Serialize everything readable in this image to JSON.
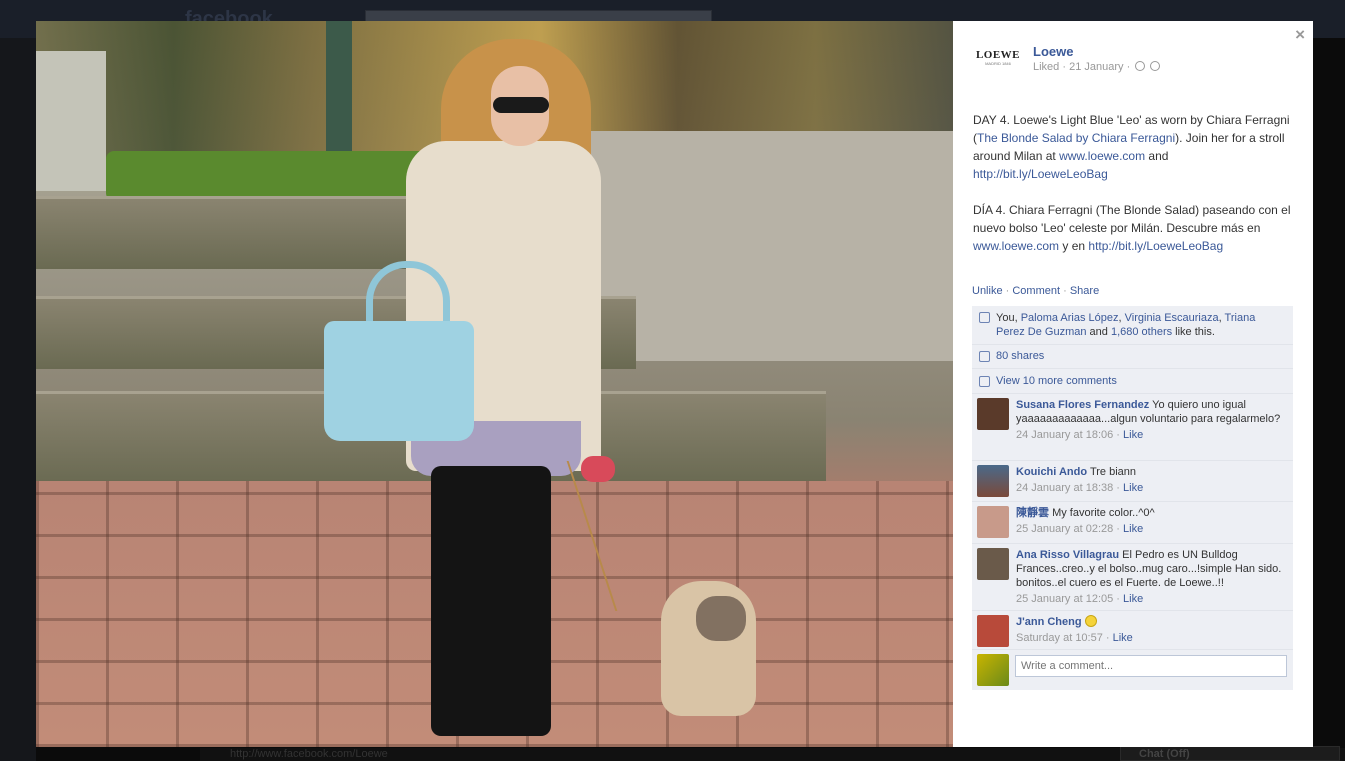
{
  "background_page": {
    "site_logo": "facebook",
    "status_url": "http://www.facebook.com/Loewe",
    "chat_label": "Chat (Off)"
  },
  "photo": {
    "alt": "Chiara Ferragni walking a French bulldog, carrying a light blue Loewe Leo bag"
  },
  "close_label": "×",
  "post": {
    "page_name": "Loewe",
    "logo_word": "LOEWE",
    "logo_sub": "MADRID 1846",
    "meta_liked": "Liked",
    "meta_date": "21 January",
    "text_en_1": "DAY 4. Loewe's Light Blue 'Leo' as worn by Chiara Ferragni (",
    "link_blonde_salad": "The Blonde Salad by Chiara Ferragni",
    "text_en_2": "). Join her for a stroll around Milan at ",
    "link_site": "www.loewe.com",
    "text_en_3": " and",
    "link_bitly": "http://bit.ly/LoeweLeoBag",
    "text_es_1": "DÍA 4. Chiara Ferragni (The Blonde Salad) paseando con el nuevo bolso 'Leo' celeste por Milán. Descubre más en ",
    "text_es_2": " y en",
    "actions": {
      "unlike": "Unlike",
      "comment": "Comment",
      "share": "Share",
      "sep": " · "
    }
  },
  "likes": {
    "you": "You, ",
    "names": [
      "Paloma Arias López",
      "Virginia Escauriaza",
      "Triana Perez De Guzman"
    ],
    "and": " and ",
    "others": "1,680 others",
    "tail": " like this.",
    "comma": ", "
  },
  "shares": "80 shares",
  "view_more": "View 10 more comments",
  "comments": [
    {
      "author": "Susana Flores Fernandez",
      "text": "Yo quiero uno igual yaaaaaaaaaaaaa...algun voluntario para regalarmelo?",
      "time": "24 January at 18:06",
      "like": "Like",
      "avatar_color": "#5a3a2a"
    },
    {
      "author": "Kouichi Ando",
      "text": "Tre biann",
      "time": "24 January at 18:38",
      "like": "Like",
      "avatar_color": "#7a4a3a"
    },
    {
      "author": "陳靜雲",
      "text": "My favorite color..^0^",
      "time": "25 January at 02:28",
      "like": "Like",
      "avatar_color": "#c89a8a"
    },
    {
      "author": "Ana Risso Villagrau",
      "text": "El Pedro es UN Bulldog Frances..creo..y el bolso..mug caro...!simple Han sido. bonitos..el cuero es el Fuerte. de Loewe..!!",
      "time": "25 January at 12:05",
      "like": "Like",
      "avatar_color": "#6a5a4a"
    },
    {
      "author": "J'ann Cheng",
      "text": "",
      "time": "Saturday at 10:57",
      "like": "Like",
      "avatar_color": "#b84a3a"
    }
  ],
  "write_comment_placeholder": "Write a comment...",
  "meta_sep": " · "
}
